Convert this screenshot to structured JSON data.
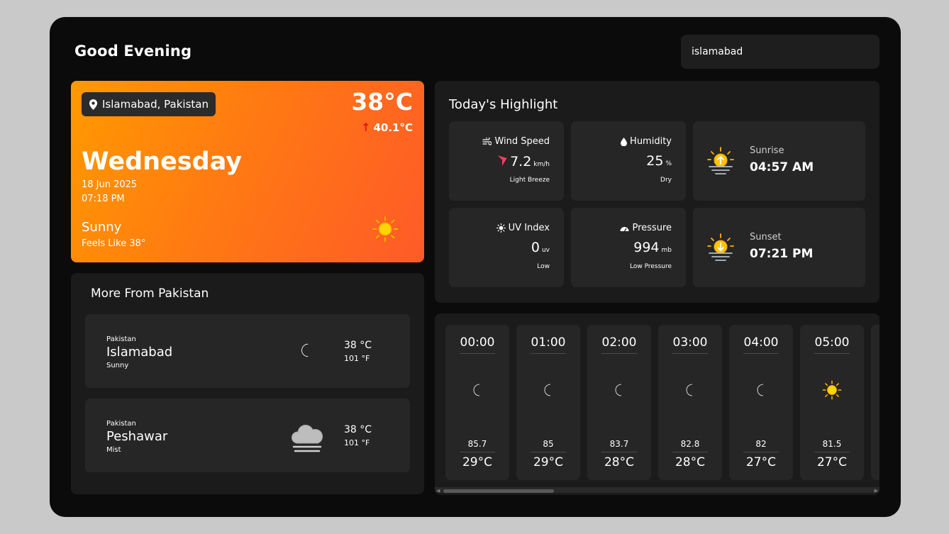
{
  "header": {
    "greeting": "Good Evening",
    "search_value": "islamabad"
  },
  "current": {
    "location": "Islamabad, Pakistan",
    "temp": "38°C",
    "max_temp": "40.1°C",
    "day": "Wednesday",
    "date": "18 Jun 2025",
    "time": "07:18 PM",
    "condition": "Sunny",
    "feels_like": "Feels Like 38°",
    "icon": "sun-icon"
  },
  "more": {
    "title": "More From Pakistan",
    "cities": [
      {
        "country": "Pakistan",
        "name": "Islamabad",
        "condition": "Sunny",
        "temp_c": "38 °C",
        "temp_f": "101 °F",
        "icon": "moon-icon"
      },
      {
        "country": "Pakistan",
        "name": "Peshawar",
        "condition": "Mist",
        "temp_c": "38 °C",
        "temp_f": "101 °F",
        "icon": "cloud-fog-icon"
      }
    ]
  },
  "highlight": {
    "title": "Today's Highlight",
    "wind": {
      "label": "Wind Speed",
      "value": "7.2",
      "unit": "km/h",
      "desc": "Light Breeze"
    },
    "humidity": {
      "label": "Humidity",
      "value": "25",
      "unit": "%",
      "desc": "Dry"
    },
    "uv": {
      "label": "UV Index",
      "value": "0",
      "unit": "uv",
      "desc": "Low"
    },
    "pressure": {
      "label": "Pressure",
      "value": "994",
      "unit": "mb",
      "desc": "Low Pressure"
    },
    "sunrise": {
      "label": "Sunrise",
      "value": "04:57 AM"
    },
    "sunset": {
      "label": "Sunset",
      "value": "07:21 PM"
    }
  },
  "hourly": [
    {
      "time": "00:00",
      "icon": "moon-icon",
      "value": "85.7",
      "temp": "29°C"
    },
    {
      "time": "01:00",
      "icon": "moon-icon",
      "value": "85",
      "temp": "29°C"
    },
    {
      "time": "02:00",
      "icon": "moon-icon",
      "value": "83.7",
      "temp": "28°C"
    },
    {
      "time": "03:00",
      "icon": "moon-icon",
      "value": "82.8",
      "temp": "28°C"
    },
    {
      "time": "04:00",
      "icon": "moon-icon",
      "value": "82",
      "temp": "27°C"
    },
    {
      "time": "05:00",
      "icon": "sun-icon",
      "value": "81.5",
      "temp": "27°C"
    }
  ],
  "colors": {
    "accent_start": "#ff9a00",
    "accent_end": "#ff5a28",
    "moon": "#1e88e5",
    "sun": "#ffc400"
  }
}
